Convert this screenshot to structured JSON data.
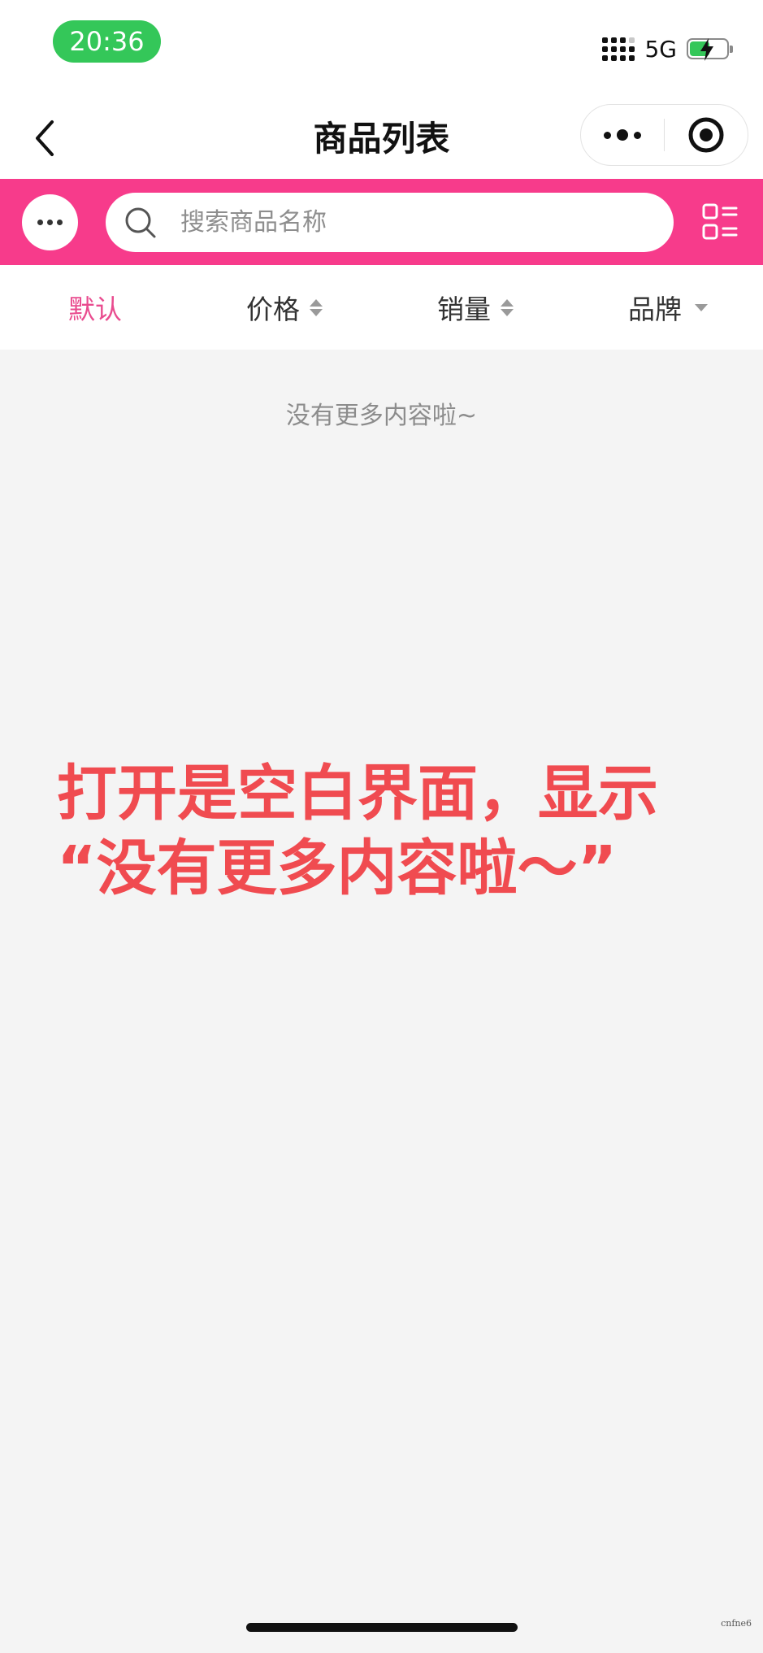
{
  "status_bar": {
    "time": "20:36",
    "network": "5G",
    "icons": [
      "signal-icon",
      "battery-charging-icon"
    ],
    "colors": {
      "time_pill": "#34c759"
    }
  },
  "header": {
    "title": "商品列表",
    "icons": [
      "back-icon",
      "more-icon",
      "target-icon"
    ]
  },
  "search": {
    "placeholder": "搜索商品名称",
    "value": "",
    "icons": [
      "menu-dots-icon",
      "search-icon",
      "grid-view-icon"
    ],
    "band_color": "#f73b8b"
  },
  "sort_tabs": [
    {
      "label": "默认",
      "active": true,
      "indicator": "none"
    },
    {
      "label": "价格",
      "active": false,
      "indicator": "sort-arrows-icon"
    },
    {
      "label": "销量",
      "active": false,
      "indicator": "sort-arrows-icon"
    },
    {
      "label": "品牌",
      "active": false,
      "indicator": "dropdown-caret-icon"
    }
  ],
  "list": {
    "empty_message": "没有更多内容啦~"
  },
  "annotation": {
    "line1": "打开是空白界面，显示",
    "line2": "“没有更多内容啦～”",
    "color": "#f04b50"
  },
  "watermark": "cnfne6",
  "theme": {
    "active_tab": "#e94c8f"
  }
}
